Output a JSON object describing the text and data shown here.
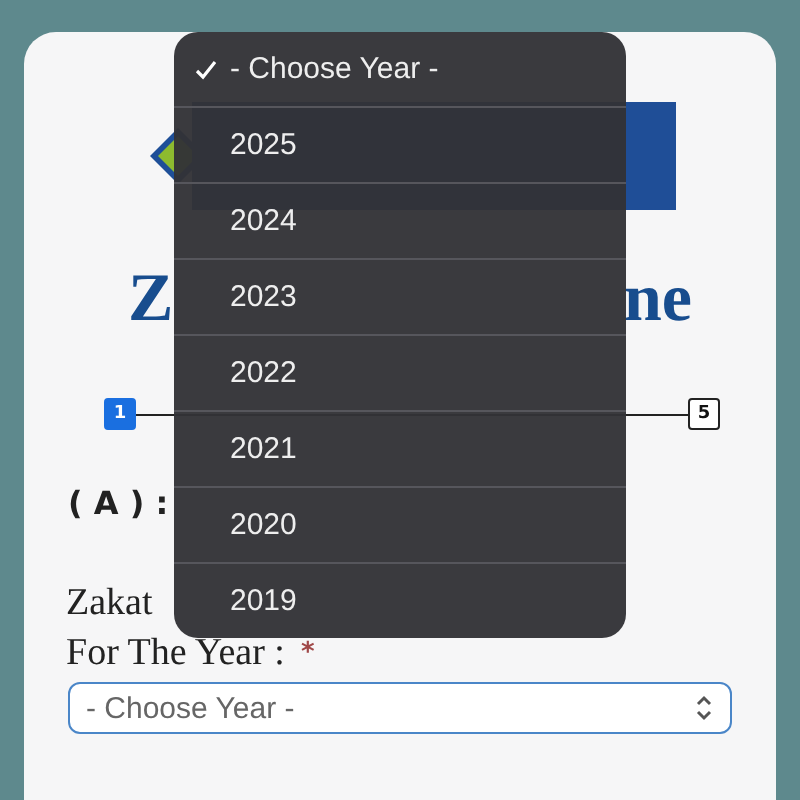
{
  "menu": {
    "options": [
      {
        "label": "- Choose Year -",
        "selected": true
      },
      {
        "label": "2025",
        "selected": false
      },
      {
        "label": "2024",
        "selected": false
      },
      {
        "label": "2023",
        "selected": false
      },
      {
        "label": "2022",
        "selected": false
      },
      {
        "label": "2021",
        "selected": false
      },
      {
        "label": "2020",
        "selected": false
      },
      {
        "label": "2019",
        "selected": false
      }
    ]
  },
  "heading": {
    "left": "Z",
    "right": "ne"
  },
  "stepper": {
    "steps": [
      {
        "label": "1",
        "selected": true
      },
      {
        "label": "5",
        "selected": false
      }
    ]
  },
  "section_title": "( A ) :",
  "field": {
    "label_lines": [
      "Zakat",
      "For The Year :"
    ],
    "required_mark": "*",
    "value": "- Choose Year -"
  }
}
